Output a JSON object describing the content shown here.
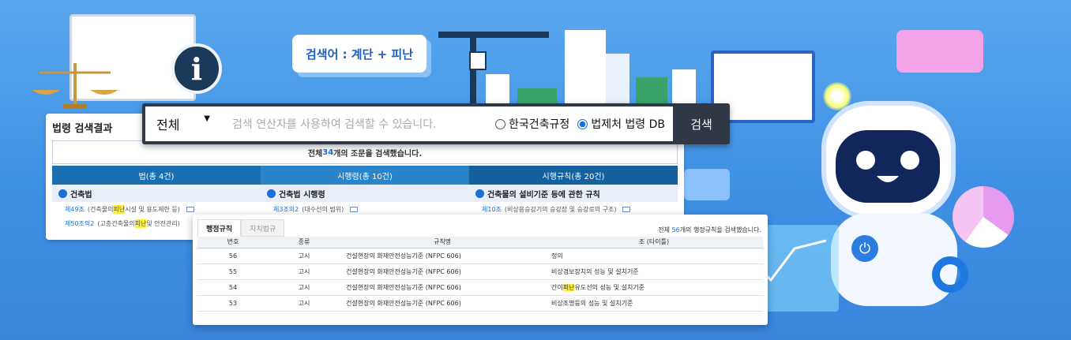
{
  "keyword_bubble": "검색어 : 계단 + 피난",
  "search": {
    "scope": "전체",
    "placeholder": "검색 연산자를 사용하여 검색할 수 있습니다.",
    "radio_1": "한국건축규정",
    "radio_2": "법제처 법령 DB",
    "button": "검색"
  },
  "panel": {
    "title": "법령 검색결과",
    "summary_pre": "전체 ",
    "summary_count": "34",
    "summary_post": "개의 조문을 검색했습니다.",
    "columns": [
      {
        "head": "법(총 4건)",
        "sub": "건축법",
        "rows": [
          {
            "a": "제49조",
            "pre": "(건축물의 ",
            "hl": "피난",
            "post": "시설 및 용도제한 등)"
          },
          {
            "a": "제50조의2",
            "pre": "(고층건축물의 ",
            "hl": "피난",
            "post": " 및 안전관리)"
          }
        ]
      },
      {
        "head": "시행령(총 10건)",
        "sub": "건축법 시행령",
        "rows": [
          {
            "a": "제3조의2",
            "pre": "(대수선의 범위)",
            "hl": "",
            "post": ""
          }
        ]
      },
      {
        "head": "시행규칙(총 20건)",
        "sub": "건축물의 설비기준 등에 관한 규칙",
        "rows": [
          {
            "a": "제10조",
            "pre": "(비상용승강기의 승강장 및 승강로의 구조)",
            "hl": "",
            "post": ""
          }
        ]
      }
    ]
  },
  "rules": {
    "tab_1": "행정규칙",
    "tab_2": "자치법규",
    "summary_pre": "전체 ",
    "summary_count": "56",
    "summary_post": "개의 행정규칙을 검색했습니다.",
    "headers": [
      "번호",
      "종류",
      "규칙명",
      "조 (타이틀)"
    ],
    "rows": [
      {
        "no": "56",
        "kind": "고시",
        "name": "건설현장의 화재안전성능기준 (NFPC 606)",
        "pre": "정의",
        "hl": "",
        "post": ""
      },
      {
        "no": "55",
        "kind": "고시",
        "name": "건설현장의 화재안전성능기준 (NFPC 606)",
        "pre": "비상경보장치의 성능 및 설치기준",
        "hl": "",
        "post": ""
      },
      {
        "no": "54",
        "kind": "고시",
        "name": "건설현장의 화재안전성능기준 (NFPC 606)",
        "pre": "간이",
        "hl": "피난",
        "post": "유도선의 성능 및 설치기준"
      },
      {
        "no": "53",
        "kind": "고시",
        "name": "건설현장의 화재안전성능기준 (NFPC 606)",
        "pre": "비상조명등의 성능 및 설치기준",
        "hl": "",
        "post": ""
      }
    ]
  },
  "icons": {
    "info": "i",
    "power": "⏻",
    "dropdown": "▼"
  }
}
